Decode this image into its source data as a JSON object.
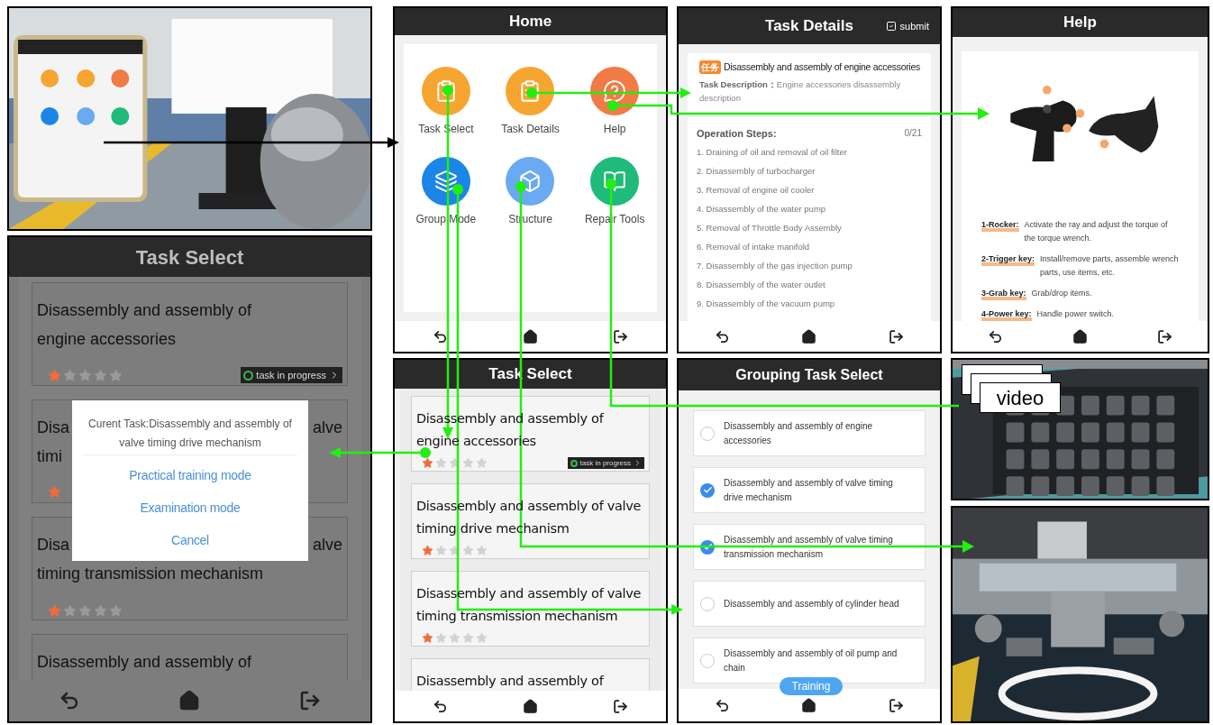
{
  "home": {
    "title": "Home",
    "apps": [
      {
        "label": "Task Select",
        "kind": "clipboard-check",
        "color": "#f7a531"
      },
      {
        "label": "Task Details",
        "kind": "clipboard-list",
        "color": "#f7a531"
      },
      {
        "label": "Help",
        "kind": "question",
        "color": "#f27a45"
      },
      {
        "label": "Group Mode",
        "kind": "layers",
        "color": "#1c86e8"
      },
      {
        "label": "Structure",
        "kind": "cube",
        "color": "#6aaaf2"
      },
      {
        "label": "Repair Tools",
        "kind": "book",
        "color": "#1fbb7a"
      }
    ]
  },
  "task_details": {
    "title": "Task Details",
    "submit": "submit",
    "badge": "任务",
    "task_title": "Disassembly and assembly of engine accessories",
    "description_label": "Task Description：",
    "description": "Engine accessories disassembly description",
    "steps_title": "Operation Steps:",
    "progress": "0/21",
    "steps": [
      "1. Draining of oil and removal of oil filter",
      "2. Disassembly of turbocharger",
      "3. Removal of engine oil cooler",
      "4. Disassembly of the water pump",
      "5. Removal of Throttle Body Assembly",
      "6. Removal of intake manifold",
      "7. Disassembly of the gas injection pump",
      "8. Disassembly of the water outlet",
      "9. Disassembly of the vacuum pump"
    ]
  },
  "help": {
    "title": "Help",
    "keys": [
      {
        "key": "1-Rocker:",
        "text": "Activate the ray and adjust the torque of the torque wrench."
      },
      {
        "key": "2-Trigger key:",
        "text": "Install/remove parts, assemble wrench parts, use items, etc."
      },
      {
        "key": "3-Grab key:",
        "text": "Grab/drop items."
      },
      {
        "key": "4-Power key:",
        "text": "Handle power switch."
      }
    ]
  },
  "task_select_dialog": {
    "title": "Task Select",
    "cards": [
      {
        "lines": [
          {
            "left": "Disassembly and assembly of"
          },
          {
            "left": "engine accessories"
          }
        ],
        "stars": 1,
        "status": "task in progress"
      },
      {
        "lines": [
          {
            "left": "Disa",
            "right": "alve"
          },
          {
            "left": "timi"
          }
        ],
        "kind": "covered"
      },
      {
        "lines": [
          {
            "left": "Disa",
            "right": "alve"
          },
          {
            "left": "timing transmission mechanism"
          }
        ],
        "stars": 1
      },
      {
        "lines": [
          {
            "left": "Disassembly and assembly of"
          }
        ]
      }
    ],
    "dialog": {
      "message": "Curent Task:Disassembly and assembly of valve timing drive mechanism",
      "options": [
        "Practical training mode",
        "Examination mode",
        "Cancel"
      ]
    }
  },
  "task_select": {
    "title": "Task Select",
    "cards": [
      {
        "title": "Disassembly and assembly of engine accessories",
        "stars": 1,
        "status": "task in progress"
      },
      {
        "title": "Disassembly and assembly of valve timing drive mechanism",
        "stars": 1
      },
      {
        "title": "Disassembly and assembly of valve timing transmission mechanism",
        "stars": 1
      },
      {
        "title": "Disassembly and assembly of"
      }
    ]
  },
  "grouping": {
    "title": "Grouping Task Select",
    "button": "Training",
    "tasks": [
      {
        "label": "Disassembly and assembly of engine accessories",
        "checked": false
      },
      {
        "label": "Disassembly and assembly of valve timing drive mechanism",
        "checked": true
      },
      {
        "label": "Disassembly and assembly of valve timing transmission mechanism",
        "checked": true
      },
      {
        "label": "Disassembly and assembly of cylinder head",
        "checked": false
      },
      {
        "label": "Disassembly and assembly of oil pump and chain",
        "checked": false
      }
    ]
  },
  "video_label": "video"
}
